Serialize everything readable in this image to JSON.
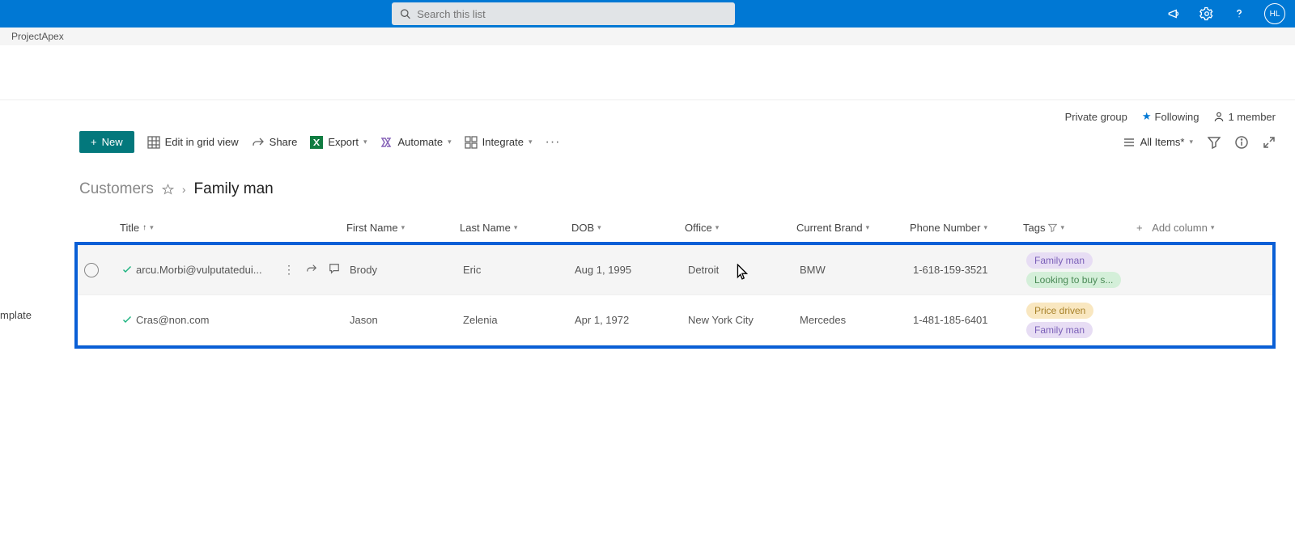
{
  "topbar": {
    "search_placeholder": "Search this list",
    "avatar_initials": "HL"
  },
  "subbar": {
    "site_name": "ProjectApex"
  },
  "sidebar": {
    "cutoff_label": "mplate"
  },
  "info": {
    "privacy": "Private group",
    "following": "Following",
    "members": "1 member"
  },
  "commands": {
    "new": "New",
    "edit_grid": "Edit in grid view",
    "share": "Share",
    "export": "Export",
    "automate": "Automate",
    "integrate": "Integrate",
    "view_name": "All Items*"
  },
  "breadcrumb": {
    "parent": "Customers",
    "current": "Family man"
  },
  "columns": {
    "title": "Title",
    "first_name": "First Name",
    "last_name": "Last Name",
    "dob": "DOB",
    "office": "Office",
    "brand": "Current Brand",
    "phone": "Phone Number",
    "tags": "Tags",
    "add": "Add column"
  },
  "rows": [
    {
      "title": "arcu.Morbi@vulputatedui...",
      "first_name": "Brody",
      "last_name": "Eric",
      "dob": "Aug 1, 1995",
      "office": "Detroit",
      "brand": "BMW",
      "phone": "1-618-159-3521",
      "tags": [
        {
          "text": "Family man",
          "style": "purple"
        },
        {
          "text": "Looking to buy s...",
          "style": "green"
        }
      ],
      "hovered": true
    },
    {
      "title": "Cras@non.com",
      "first_name": "Jason",
      "last_name": "Zelenia",
      "dob": "Apr 1, 1972",
      "office": "New York City",
      "brand": "Mercedes",
      "phone": "1-481-185-6401",
      "tags": [
        {
          "text": "Price driven",
          "style": "yellow"
        },
        {
          "text": "Family man",
          "style": "purple"
        }
      ],
      "hovered": false
    }
  ]
}
